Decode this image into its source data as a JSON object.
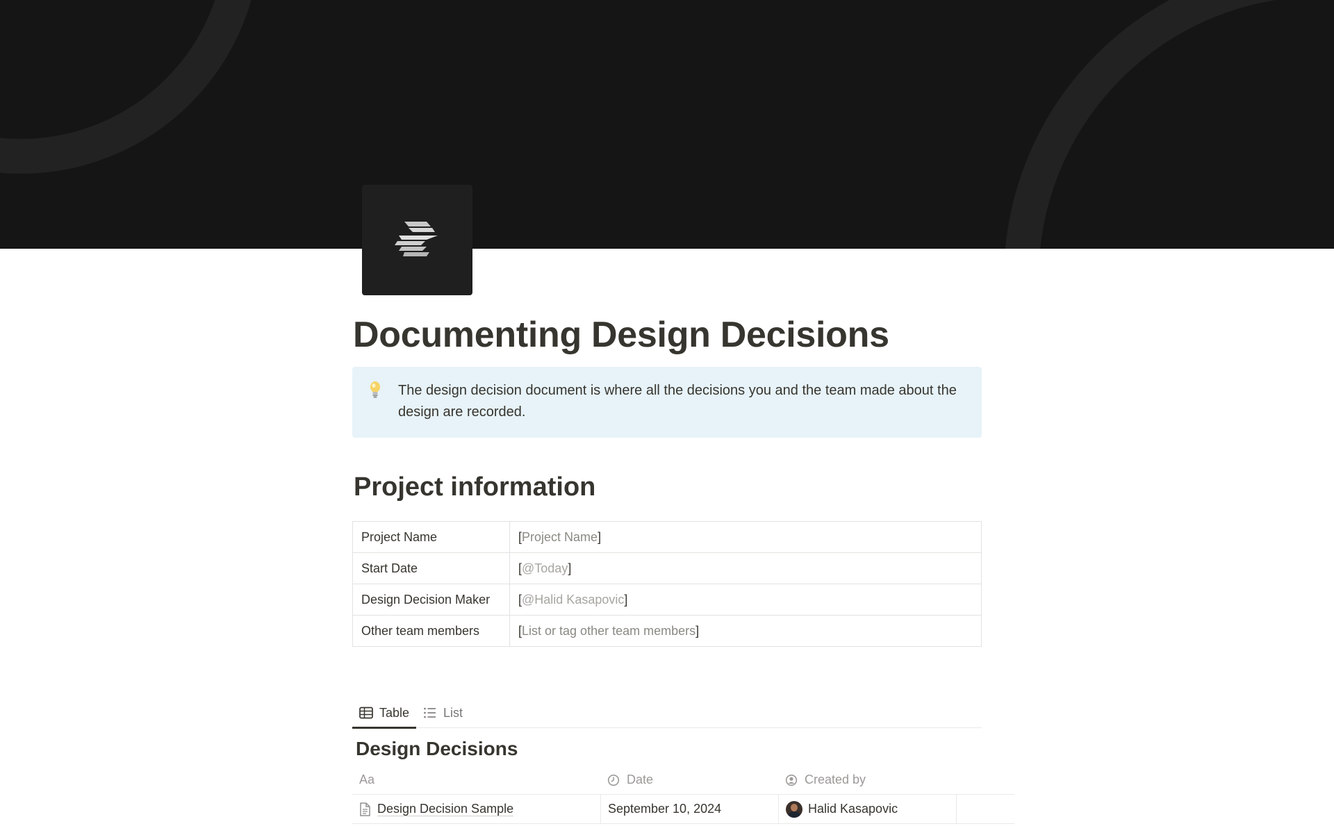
{
  "page": {
    "title": "Documenting Design Decisions"
  },
  "cover": {
    "background": "#151515",
    "decoration_color": "#222222"
  },
  "page_icon": {
    "icon": "stacked-stripes-logo",
    "background": "#1f1f1f"
  },
  "callout": {
    "icon": "lightbulb-icon",
    "text": "The design decision document is where all the decisions you and the team made about the design are recorded.",
    "background": "#e7f3f8"
  },
  "project_info": {
    "heading": "Project information",
    "rows": [
      {
        "key": "Project Name",
        "open": "[",
        "value": "Project Name",
        "close": "]"
      },
      {
        "key": "Start Date",
        "open": "[",
        "value": "@Today",
        "close": "]"
      },
      {
        "key": "Design Decision Maker",
        "open": "[",
        "value": "@Halid Kasapovic",
        "close": "]"
      },
      {
        "key": "Other team members",
        "open": "[",
        "value": "List or tag other team members",
        "close": "]"
      }
    ]
  },
  "views": {
    "tabs": [
      {
        "label": "Table",
        "icon": "table-icon",
        "active": true
      },
      {
        "label": "List",
        "icon": "list-icon",
        "active": false
      }
    ]
  },
  "database": {
    "title": "Design Decisions",
    "columns": [
      {
        "label": "Aa",
        "icon": ""
      },
      {
        "label": "Date",
        "icon": "clock-icon"
      },
      {
        "label": "Created by",
        "icon": "person-circle-icon"
      }
    ],
    "rows": [
      {
        "name": "Design Decision Sample",
        "date": "September 10, 2024",
        "created_by": "Halid Kasapovic"
      }
    ]
  }
}
